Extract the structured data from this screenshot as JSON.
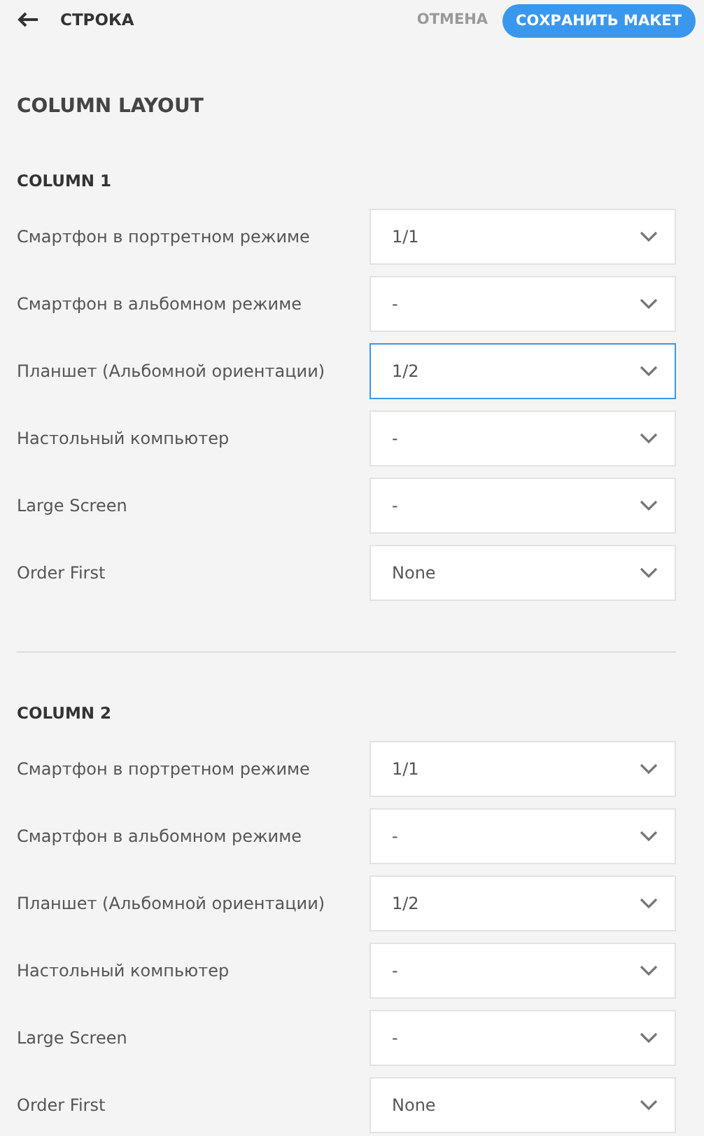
{
  "header": {
    "back_label": "СТРОКА",
    "cancel": "ОТМЕНА",
    "save": "СОХРАНИТЬ МАКЕТ"
  },
  "title": "COLUMN LAYOUT",
  "columns": [
    {
      "heading": "COLUMN 1",
      "fields": [
        {
          "label": "Смартфон в портретном режиме",
          "value": "1/1",
          "focused": false
        },
        {
          "label": "Смартфон в альбомном режиме",
          "value": "-",
          "focused": false
        },
        {
          "label": "Планшет (Альбомной ориентации)",
          "value": "1/2",
          "focused": true
        },
        {
          "label": "Настольный компьютер",
          "value": "-",
          "focused": false
        },
        {
          "label": "Large Screen",
          "value": "-",
          "focused": false
        },
        {
          "label": "Order First",
          "value": "None",
          "focused": false
        }
      ]
    },
    {
      "heading": "COLUMN 2",
      "fields": [
        {
          "label": "Смартфон в портретном режиме",
          "value": "1/1",
          "focused": false
        },
        {
          "label": "Смартфон в альбомном режиме",
          "value": "-",
          "focused": false
        },
        {
          "label": "Планшет (Альбомной ориентации)",
          "value": "1/2",
          "focused": false
        },
        {
          "label": "Настольный компьютер",
          "value": "-",
          "focused": false
        },
        {
          "label": "Large Screen",
          "value": "-",
          "focused": false
        },
        {
          "label": "Order First",
          "value": "None",
          "focused": false
        }
      ]
    }
  ]
}
